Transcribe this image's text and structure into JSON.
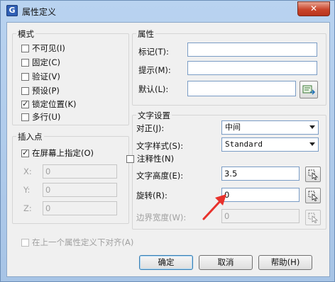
{
  "window": {
    "title": "属性定义",
    "app_icon_letter": "G",
    "close_glyph": "✕"
  },
  "mode": {
    "title": "模式",
    "options": [
      {
        "label": "不可见(I)",
        "checked": false
      },
      {
        "label": "固定(C)",
        "checked": false
      },
      {
        "label": "验证(V)",
        "checked": false
      },
      {
        "label": "预设(P)",
        "checked": false
      },
      {
        "label": "锁定位置(K)",
        "checked": true
      },
      {
        "label": "多行(U)",
        "checked": false
      }
    ]
  },
  "insertion_point": {
    "title": "插入点",
    "specify_on_screen": {
      "label": "在屏幕上指定(O)",
      "checked": true
    },
    "x": {
      "label": "X:",
      "value": "0"
    },
    "y": {
      "label": "Y:",
      "value": "0"
    },
    "z": {
      "label": "Z:",
      "value": "0"
    }
  },
  "attribute": {
    "title": "属性",
    "tag": {
      "label": "标记(T):",
      "value": ""
    },
    "prompt": {
      "label": "提示(M):",
      "value": ""
    },
    "default": {
      "label": "默认(L):",
      "value": ""
    }
  },
  "text_settings": {
    "title": "文字设置",
    "justification": {
      "label": "对正(J):",
      "value": "中间"
    },
    "text_style": {
      "label": "文字样式(S):",
      "value": "Standard"
    },
    "annotative": {
      "label": "注释性(N)",
      "checked": false
    },
    "text_height": {
      "label": "文字高度(E):",
      "value": "3.5"
    },
    "rotation": {
      "label": "旋转(R):",
      "value": "0"
    },
    "boundary_width": {
      "label": "边界宽度(W):",
      "value": "0"
    }
  },
  "align_below": {
    "label": "在上一个属性定义下对齐(A)",
    "checked": false
  },
  "buttons": {
    "ok": "确定",
    "cancel": "取消",
    "help": "帮助(H)"
  },
  "annotation": {
    "arrow_color": "#e8322c"
  }
}
